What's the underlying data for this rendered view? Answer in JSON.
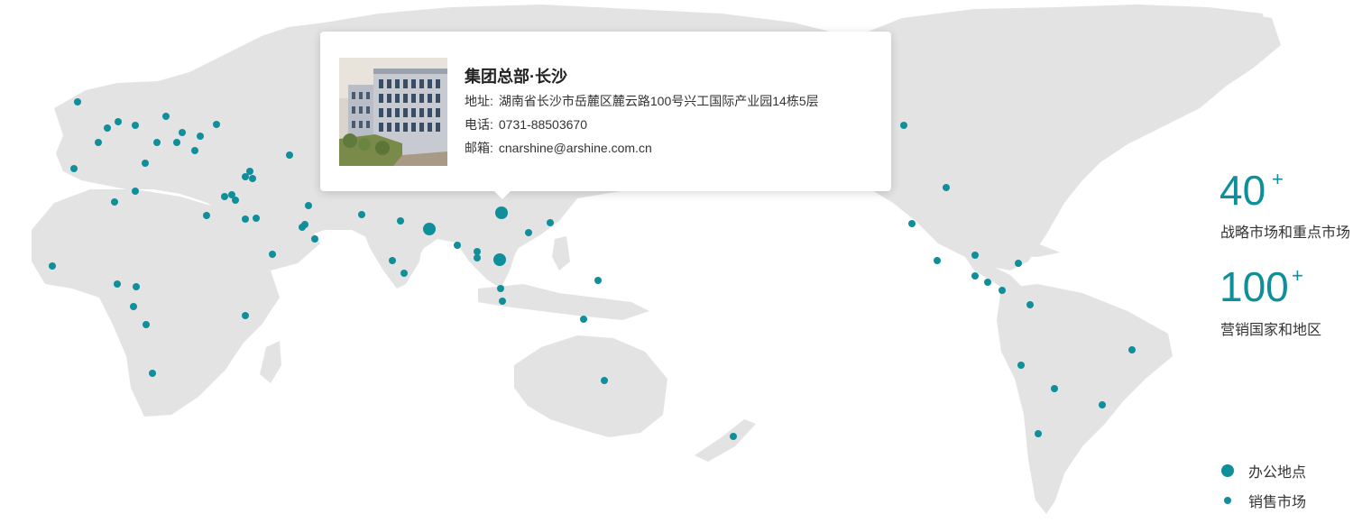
{
  "popup": {
    "title": "集团总部·长沙",
    "address_label": "地址:",
    "address": "湖南省长沙市岳麓区麓云路100号兴工国际产业园14栋5层",
    "phone_label": "电话:",
    "phone": "0731-88503670",
    "email_label": "邮箱:",
    "email": "cnarshine@arshine.com.cn"
  },
  "stats": [
    {
      "number": "40",
      "suffix": "+",
      "label": "战略市场和重点市场"
    },
    {
      "number": "100",
      "suffix": "+",
      "label": "营销国家和地区"
    }
  ],
  "legend": {
    "office": "办公地点",
    "sales": "销售市场"
  },
  "colors": {
    "accent": "#0e8f9a",
    "land": "#e3e3e3"
  }
}
